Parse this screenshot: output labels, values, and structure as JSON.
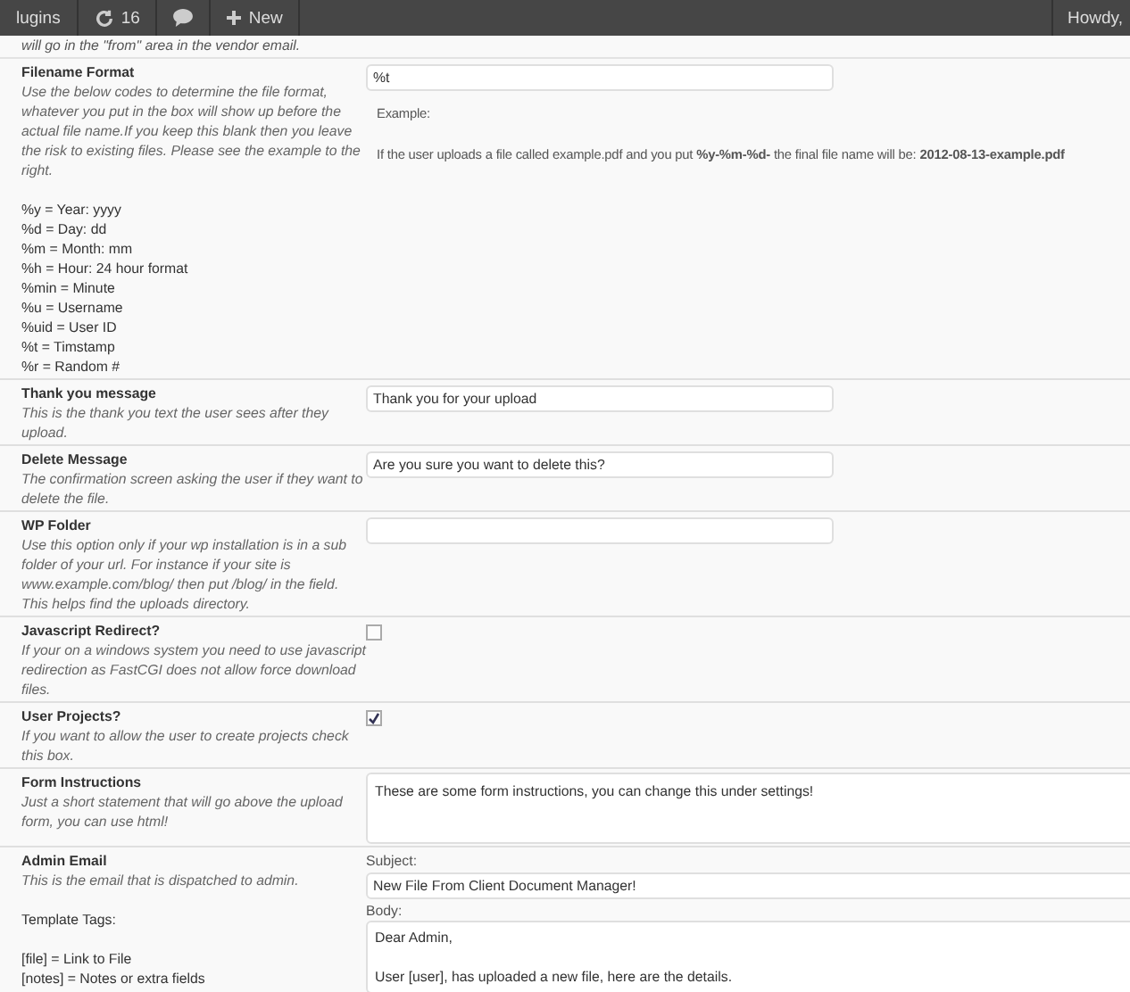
{
  "admin_bar": {
    "items": [
      {
        "kind": "text",
        "label": "lugins"
      },
      {
        "kind": "updates",
        "label": "16"
      },
      {
        "kind": "comments"
      },
      {
        "kind": "new",
        "label": "New"
      }
    ],
    "greeting": "Howdy,"
  },
  "top_note": "will go in the \"from\" area in the vendor email.",
  "rows": [
    {
      "kind": "format",
      "label": "Filename Format",
      "description": "Use the below codes to determine the file format, whatever you put in the box will show up before the actual file name.If you keep this blank then you leave the risk to existing files. Please see the example to the right.",
      "codes": [
        "%y = Year: yyyy",
        "%d = Day: dd",
        "%m = Month: mm",
        "%h = Hour: 24 hour format",
        "%min = Minute",
        "%u = Username",
        "%uid = User ID",
        "%t = Timstamp",
        "%r = Random #"
      ],
      "value": "%t",
      "example_label": "Example:",
      "example_text": "If the user uploads a file called example.pdf and you put **%y-%m-%d-** the final file name will be: **2012-08-13-example.pdf**"
    },
    {
      "kind": "text",
      "label": "Thank you message",
      "description": "This is the thank you text the user sees after they upload.",
      "value": "Thank you for your upload"
    },
    {
      "kind": "text",
      "label": "Delete Message",
      "description": "The confirmation screen asking the user if they want to delete the file.",
      "value": "Are you sure you want to delete this?"
    },
    {
      "kind": "text",
      "label": "WP Folder",
      "description": "Use this option only if your wp installation is in a sub folder of your url. For instance if your site is www.example.com/blog/ then put /blog/ in the field. This helps find the uploads directory."
    },
    {
      "kind": "checkbox",
      "label": "Javascript Redirect?",
      "description": "If your on a windows system you need to use javascript redirection as FastCGI does not allow force download files.",
      "checked": false
    },
    {
      "kind": "checkbox",
      "label": "User Projects?",
      "description": "If you want to allow the user to create projects check this box.",
      "checked": true
    },
    {
      "kind": "textarea",
      "label": "Form Instructions",
      "description": "Just a short statement that will go above the upload form, you can use html!",
      "value": "These are some form instructions, you can change this under settings!"
    },
    {
      "kind": "email",
      "label": "Admin Email",
      "description": "This is the email that is dispatched to admin.",
      "tags_label": "Template Tags:",
      "tags": [
        "[file] = Link to File",
        "[notes] = Notes or extra fields"
      ],
      "subject_label": "Subject:",
      "subject": "New File From Client Document Manager!",
      "body_label": "Body:",
      "body": "Dear Admin,\n\nUser [user], has uploaded a new file, here are the details."
    }
  ]
}
